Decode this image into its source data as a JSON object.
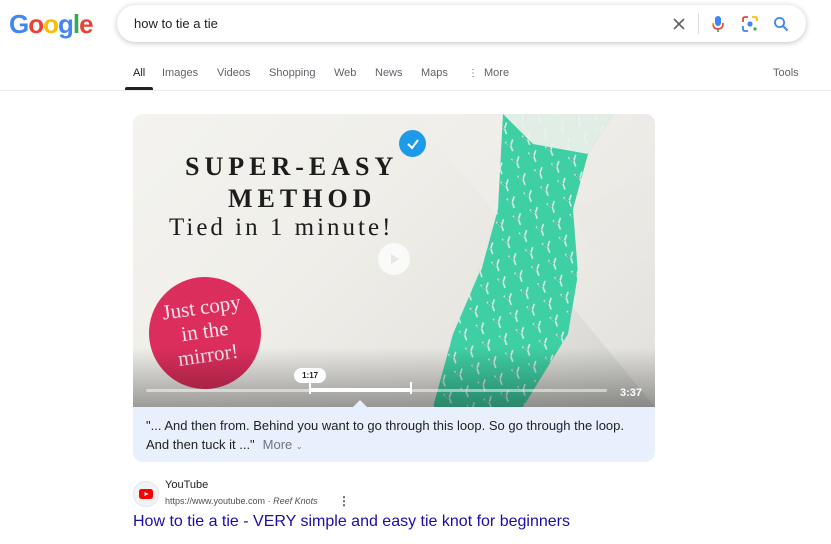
{
  "header": {
    "logo": {
      "letters": [
        "G",
        "o",
        "o",
        "g",
        "l",
        "e"
      ]
    },
    "search": {
      "query": "how to tie a tie"
    },
    "icons": {
      "clear": "close-icon",
      "voice": "microphone-icon",
      "lens": "camera-lens-icon",
      "search": "search-icon"
    }
  },
  "tabs": {
    "items": [
      {
        "label": "All",
        "active": true
      },
      {
        "label": "Images"
      },
      {
        "label": "Videos"
      },
      {
        "label": "Shopping"
      },
      {
        "label": "Web"
      },
      {
        "label": "News"
      },
      {
        "label": "Maps"
      },
      {
        "label": "More",
        "icon": "vertical-dots-icon"
      }
    ],
    "tools": "Tools"
  },
  "video": {
    "thumbnail_text": {
      "line1": "SUPER-EASY",
      "line2": "METHOD",
      "line3": "Tied in 1 minute!",
      "badge_line1": "Just copy",
      "badge_line2": "in the",
      "badge_line3": "mirror!"
    },
    "key_moment_time": "1:17",
    "duration": "3:37",
    "segment": {
      "start_fraction": 0.356,
      "end_fraction": 0.575
    },
    "transcript": "\"... And then from. Behind you want to go through this loop. So go through the loop. And then tuck it ...\"",
    "more_label": "More"
  },
  "result": {
    "site_name": "YouTube",
    "url": "https://www.youtube.com",
    "separator": "·",
    "channel": "Reef Knots",
    "title": "How to tie a tie - VERY simple and easy tie knot for beginners"
  },
  "colors": {
    "link": "#1a0dab",
    "transcript_bg": "#e8f0fe",
    "verified_blue": "#1e9be8",
    "badge_pink": "#dc2e5c",
    "tie_green": "#3fcfa4"
  }
}
